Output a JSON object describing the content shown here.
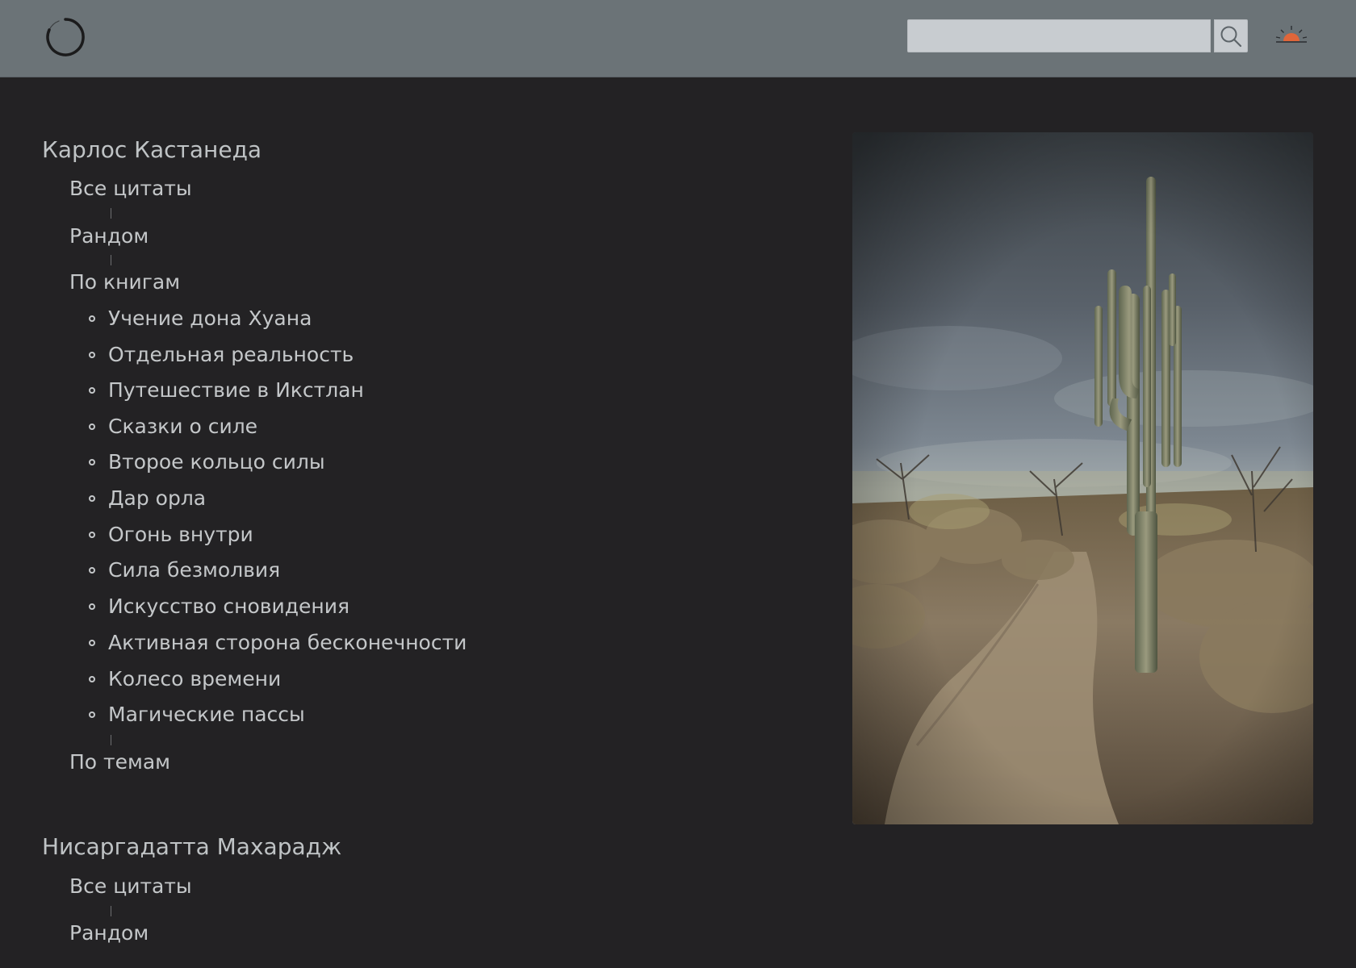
{
  "header": {
    "logo_icon": "loading-circle-icon",
    "search": {
      "placeholder": "",
      "value": ""
    },
    "search_icon": "search-icon",
    "theme_icon": "sunset-icon"
  },
  "nav": {
    "authors": [
      {
        "name": "Карлос Кастанеда",
        "all_quotes": "Все цитаты",
        "random": "Рандом",
        "by_books": "По книгам",
        "books": [
          "Учение дона Хуана",
          "Отдельная реальность",
          "Путешествие в Икстлан",
          "Сказки о силе",
          "Второе кольцо силы",
          "Дар орла",
          "Огонь внутри",
          "Сила безмолвия",
          "Искусство сновидения",
          "Активная сторона бесконечности",
          "Колесо времени",
          "Магические пассы"
        ],
        "by_topics": "По темам"
      },
      {
        "name": "Нисаргадатта Махарадж",
        "all_quotes": "Все цитаты",
        "random": "Рандом"
      }
    ]
  },
  "colors": {
    "header_bg": "#6b7377",
    "page_bg": "#232224",
    "text": "#c4c7c9",
    "sun_accent": "#e0663a"
  }
}
